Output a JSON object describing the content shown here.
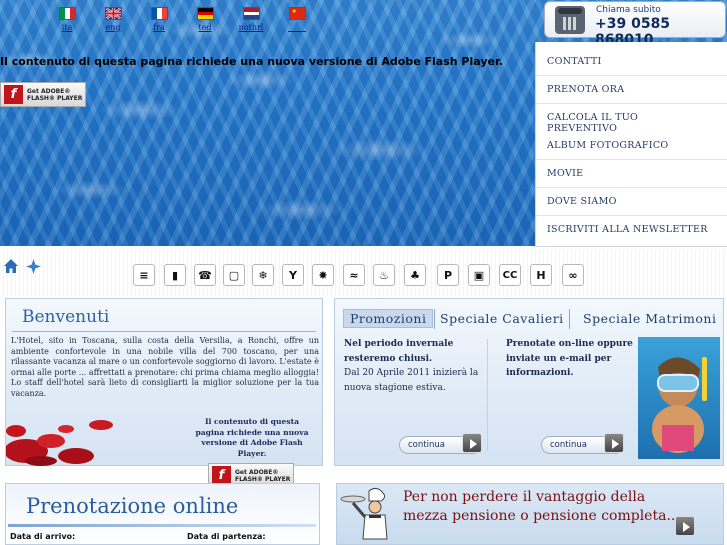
{
  "languages": [
    {
      "label": "ita",
      "flag": "flag-italy-icon",
      "colors": [
        "#009246",
        "#ffffff",
        "#ce2b37"
      ]
    },
    {
      "label": "eng",
      "flag": "flag-uk-icon",
      "colors": [
        "#012169",
        "#ffffff",
        "#c8102e"
      ]
    },
    {
      "label": "fra",
      "flag": "flag-france-icon",
      "colors": [
        "#0055a4",
        "#ffffff",
        "#ef4135"
      ]
    },
    {
      "label": "ted",
      "flag": "flag-germany-icon",
      "colors": [
        "#000000",
        "#dd0000",
        "#ffce00"
      ]
    },
    {
      "label": "nothrl",
      "flag": "flag-netherlands-icon",
      "colors": [
        "#ae1c28",
        "#ffffff",
        "#21468b"
      ]
    },
    {
      "label": "",
      "flag": "flag-china-icon",
      "colors": [
        "#de2910",
        "#ffde00"
      ]
    }
  ],
  "header": {
    "flash_message": "Il contenuto di questa pagina richiede una nuova versione di Adobe Flash Player.",
    "flash_badge": {
      "line1": "Get ADOBE®",
      "line2": "FLASH® PLAYER",
      "logo": "f"
    }
  },
  "phone": {
    "caption": "Chiama subito",
    "number": "+39 0585 868010"
  },
  "menu": {
    "items": [
      "CONTATTI",
      "PRENOTA ORA",
      "CALCOLA IL TUO PREVENTIVO",
      "ALBUM FOTOGRAFICO",
      "MOVIE",
      "DOVE SIAMO",
      "ISCRIVITI ALLA NEWSLETTER"
    ]
  },
  "amenities": [
    {
      "name": "newspaper-icon",
      "glyph": "≡"
    },
    {
      "name": "mobile-phone-icon",
      "glyph": "▮"
    },
    {
      "name": "phone-icon",
      "glyph": "☎"
    },
    {
      "name": "tv-icon",
      "glyph": "▢"
    },
    {
      "name": "air-conditioning-icon",
      "glyph": "❄"
    },
    {
      "name": "bar-icon",
      "glyph": "Y"
    },
    {
      "name": "heating-icon",
      "glyph": "✸"
    },
    {
      "name": "pool-icon",
      "glyph": "≈"
    },
    {
      "name": "beach-icon",
      "glyph": "♨"
    },
    {
      "name": "garden-icon",
      "glyph": "♣"
    },
    {
      "name": "parking-icon",
      "glyph": "P"
    },
    {
      "name": "minibar-icon",
      "glyph": "▣"
    },
    {
      "name": "credit-card-icon",
      "glyph": "CC"
    },
    {
      "name": "hotel-icon",
      "glyph": "H"
    },
    {
      "name": "internet-icon",
      "glyph": "∞"
    }
  ],
  "welcome": {
    "title": "Benvenuti",
    "text": "L'Hotel, sito in Toscana, sulla costa della Versilia, a Ronchi, offre un ambiente confortevole in una nobile villa del 700 toscano, per una rilassante vacanza al mare o un confortevole soggiorno di lavoro. L'estate è ormai alle porte ... affrettati a prenotare: chi prima chiama meglio alloggia! Lo staff dell'hotel sarà lieto di consigliarti la miglior soluzione per la tua vacanza.",
    "flash_text": "Il contenuto di questa pagina richiede una nuova versione di Adobe Flash Player."
  },
  "promo": {
    "tabs": [
      "Promozioni",
      "Speciale Cavalieri",
      "Speciale Matrimoni"
    ],
    "col1_bold": "Nel periodo invernale resteremo chiusi.",
    "col1_text": "Dal 20 Aprile 2011 inizierà la nuova stagione estiva.",
    "col2_bold": "Prenotate on-line oppure inviate un e-mail per informazioni.",
    "continue_label": "continua"
  },
  "booking": {
    "title": "Prenotazione online",
    "arrival_label": "Data di arrivo:",
    "departure_label": "Data di partenza:"
  },
  "halfboard": {
    "line1": "Per non perdere il vantaggio della",
    "line2": "mezza pensione o pensione completa..."
  }
}
